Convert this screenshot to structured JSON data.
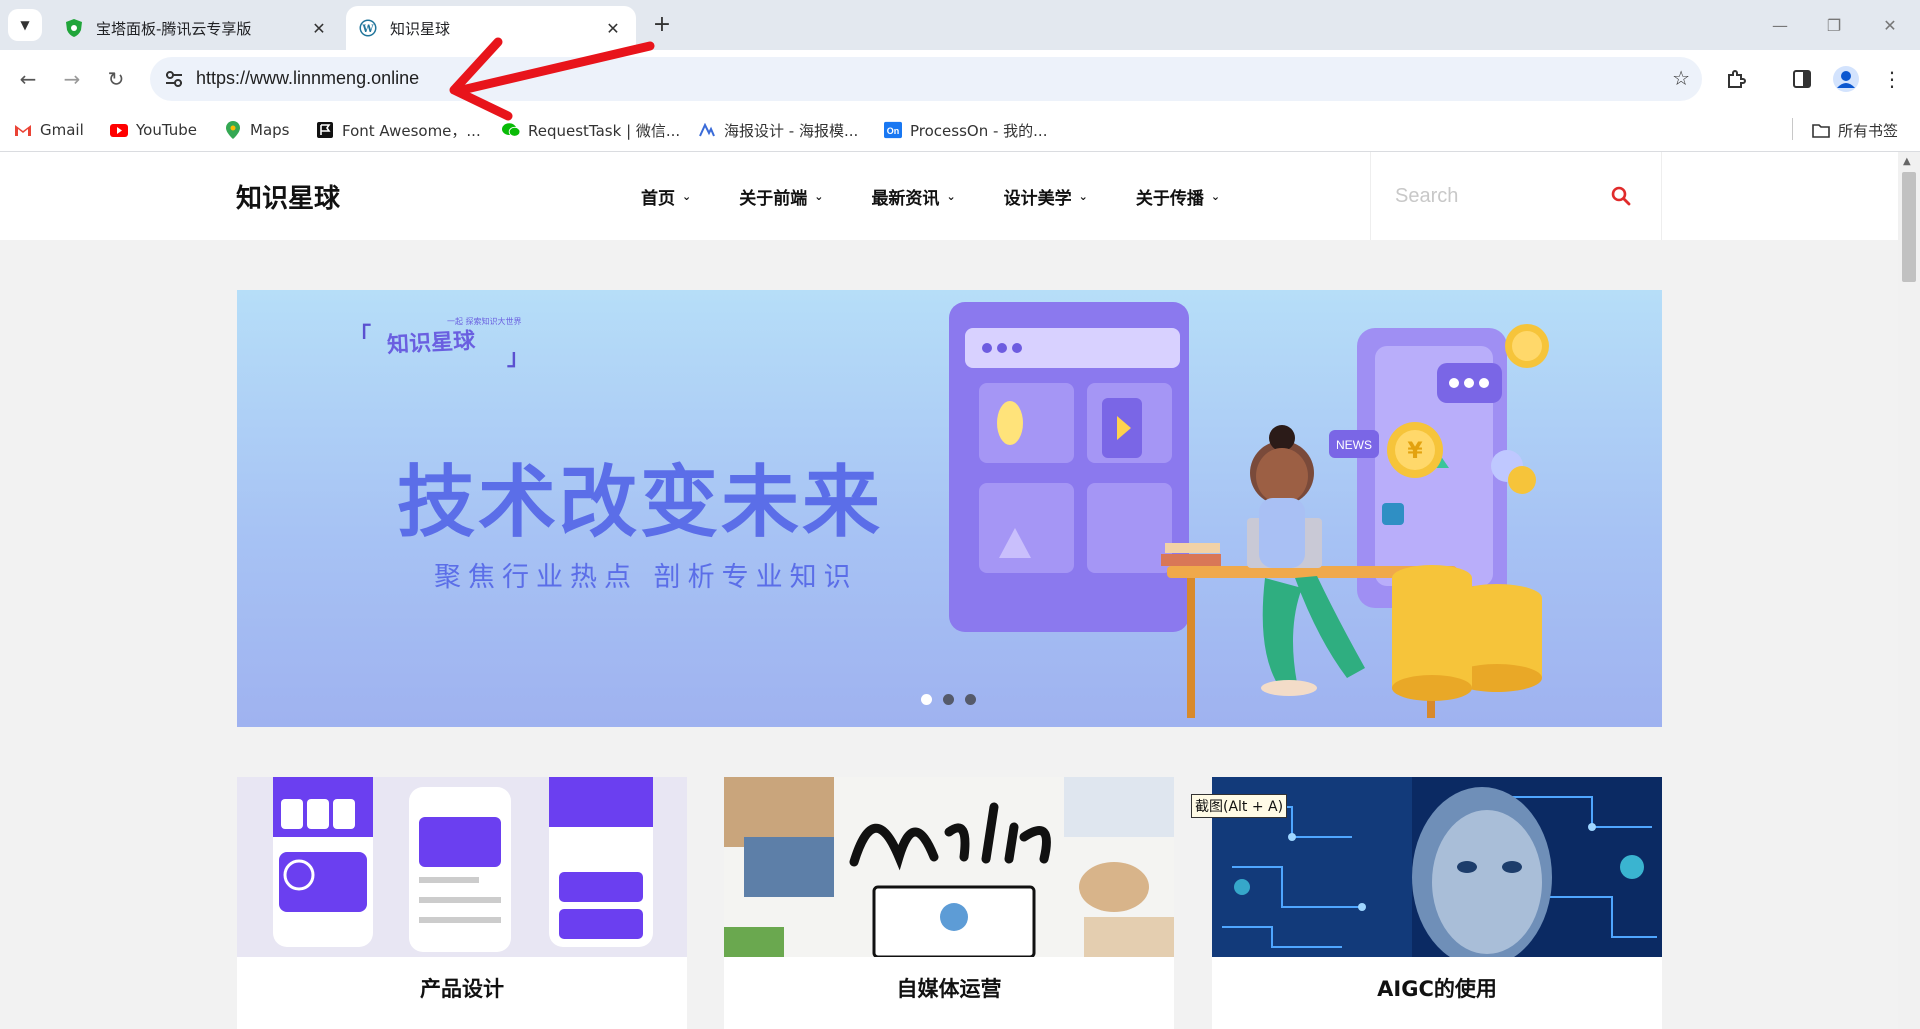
{
  "browser": {
    "tabs": [
      {
        "title": "宝塔面板-腾讯云专享版",
        "icon": "baota-shield-icon",
        "active": false
      },
      {
        "title": "知识星球",
        "icon": "wordpress-icon",
        "active": true
      }
    ],
    "url": "https://www.linnmeng.online",
    "bookmarks": [
      {
        "label": "Gmail",
        "icon": "gmail-icon"
      },
      {
        "label": "YouTube",
        "icon": "youtube-icon"
      },
      {
        "label": "Maps",
        "icon": "maps-icon"
      },
      {
        "label": "Font Awesome，...",
        "icon": "font-awesome-icon"
      },
      {
        "label": "RequestTask | 微信...",
        "icon": "wechat-icon"
      },
      {
        "label": "海报设计 - 海报模...",
        "icon": "poster-icon"
      },
      {
        "label": "ProcessOn - 我的...",
        "icon": "processon-icon"
      }
    ],
    "all_bookmarks": "所有书签"
  },
  "site": {
    "logo": "知识星球",
    "menu": [
      "首页",
      "关于前端",
      "最新资讯",
      "设计美学",
      "关于传播"
    ],
    "search_placeholder": "Search",
    "accent": "#e02b2b"
  },
  "banner": {
    "brand": "知识星球",
    "brand_sub": "一起 探索知识大世界",
    "brand_quote_open": "「",
    "brand_quote_close": "」",
    "headline": "技术改变未来",
    "subheadline": "聚焦行业热点 剖析专业知识",
    "slide_count": 3,
    "active_slide": 1
  },
  "cards": [
    {
      "title": "产品设计",
      "image": "product-design-mockup"
    },
    {
      "title": "自媒体运营",
      "image": "media-illustration"
    },
    {
      "title": "AIGC的使用",
      "image": "ai-face-circuit"
    }
  ],
  "tooltip": "截图(Alt + A)"
}
